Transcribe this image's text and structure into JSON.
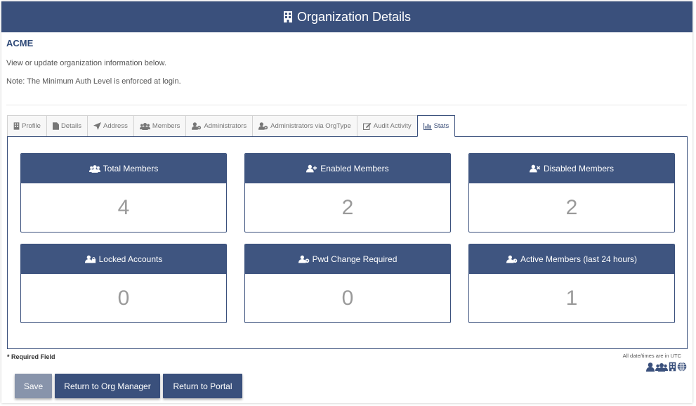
{
  "header": {
    "title": "Organization Details",
    "icon": "building-icon"
  },
  "org": {
    "name": "ACME"
  },
  "intro": "View or update organization information below.",
  "note": "Note: The Minimum Auth Level is enforced at login.",
  "tabs": [
    {
      "label": "Profile",
      "icon": "building-icon",
      "active": false
    },
    {
      "label": "Details",
      "icon": "document-icon",
      "active": false
    },
    {
      "label": "Address",
      "icon": "location-arrow-icon",
      "active": false
    },
    {
      "label": "Members",
      "icon": "users-icon",
      "active": false
    },
    {
      "label": "Administrators",
      "icon": "user-gear-icon",
      "active": false
    },
    {
      "label": "Administrators via OrgType",
      "icon": "user-gear-icon",
      "active": false
    },
    {
      "label": "Audit Activity",
      "icon": "edit-icon",
      "active": false
    },
    {
      "label": "Stats",
      "icon": "bar-chart-icon",
      "active": true
    }
  ],
  "stats": [
    {
      "label": "Total Members",
      "value": "4",
      "icon": "users-icon"
    },
    {
      "label": "Enabled Members",
      "value": "2",
      "icon": "user-plus-icon"
    },
    {
      "label": "Disabled Members",
      "value": "2",
      "icon": "user-times-icon"
    },
    {
      "label": "Locked Accounts",
      "value": "0",
      "icon": "user-lock-icon"
    },
    {
      "label": "Pwd Change Required",
      "value": "0",
      "icon": "user-gear-icon"
    },
    {
      "label": "Active Members (last 24 hours)",
      "value": "1",
      "icon": "user-clock-icon"
    }
  ],
  "footer": {
    "required": "* Required Field",
    "utc_note": "All date/times are in UTC",
    "legend_icons": [
      "user-icon",
      "users-icon",
      "building-icon",
      "globe-icon"
    ]
  },
  "buttons": {
    "save": "Save",
    "return_org": "Return to Org Manager",
    "return_portal": "Return to Portal"
  },
  "colors": {
    "primary": "#3a507c",
    "save_disabled": "#8894ab",
    "value_text": "#9a9a9a",
    "org_name": "#2f4a78"
  }
}
